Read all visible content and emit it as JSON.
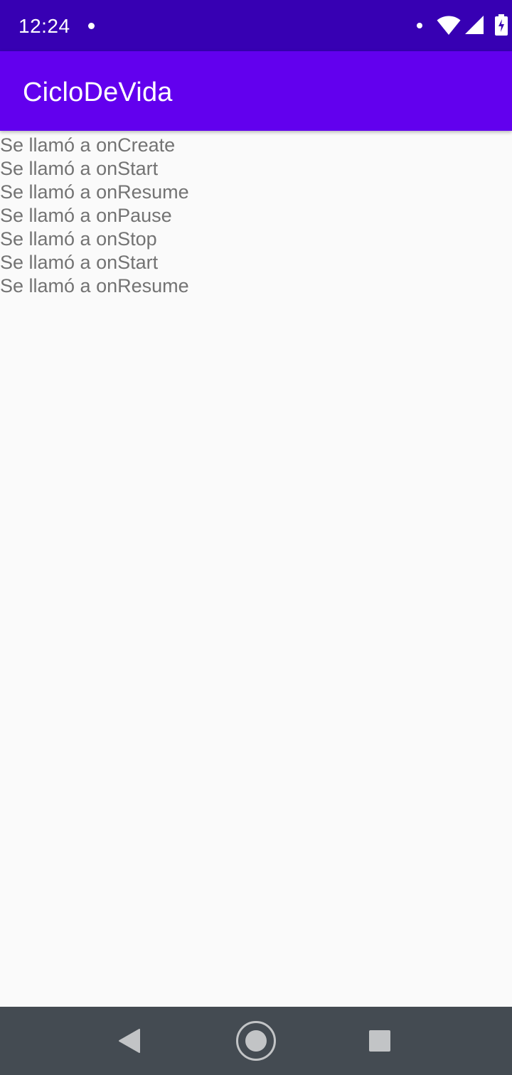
{
  "status_bar": {
    "time": "12:24",
    "icons": [
      "notification-dot",
      "wifi-icon",
      "signal-icon",
      "battery-charging-icon"
    ]
  },
  "app_bar": {
    "title": "CicloDeVida"
  },
  "log": {
    "lines": [
      "Se llamó a onCreate",
      "Se llamó a onStart",
      "Se llamó a onResume",
      "Se llamó a onPause",
      "Se llamó a onStop",
      "Se llamó a onStart",
      "Se llamó a onResume"
    ]
  },
  "nav_bar": {
    "icons": [
      "back-icon",
      "home-icon",
      "recents-icon"
    ]
  },
  "colors": {
    "status_bar": "#3700b3",
    "app_bar": "#6200ee",
    "background": "#fafafa",
    "log_text": "#737373",
    "nav_bar": "#444b52"
  }
}
